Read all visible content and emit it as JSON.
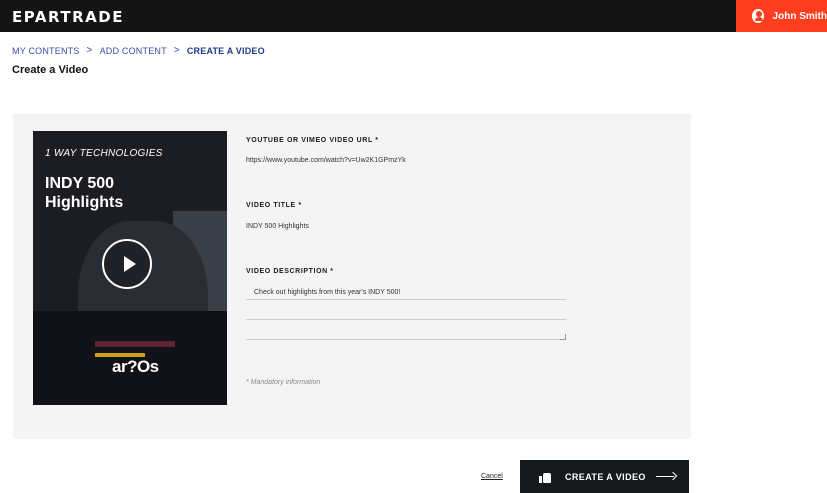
{
  "header": {
    "logo": "EPARTRADE",
    "user_name": "John Smith"
  },
  "breadcrumb": {
    "items": [
      "MY CONTENTS",
      "ADD CONTENT",
      "CREATE A VIDEO"
    ],
    "separator": ">"
  },
  "page": {
    "title": "Create a Video"
  },
  "thumbnail": {
    "kicker": "1 WAY TECHNOLOGIES",
    "title": "INDY 500 Highlights",
    "brand_text": "ar?Os"
  },
  "form": {
    "url_label": "YOUTUBE OR VIMEO VIDEO URL *",
    "url_value": "https://www.youtube.com/watch?v=Uw2K1GPmzYk",
    "title_label": "VIDEO TITLE *",
    "title_value": "INDY 500 Highlights",
    "description_label": "VIDEO DESCRIPTION *",
    "description_value": "Check out highlights from this year's INDY 500!",
    "mandatory_note": "* Mandatory information"
  },
  "actions": {
    "cancel_label": "Cancel",
    "submit_label": "CREATE A VIDEO"
  },
  "colors": {
    "topbar": "#141414",
    "accent": "#ff3d1f",
    "link": "#3a4fa8",
    "panel": "#f4f4f4",
    "button": "#171a1d"
  }
}
